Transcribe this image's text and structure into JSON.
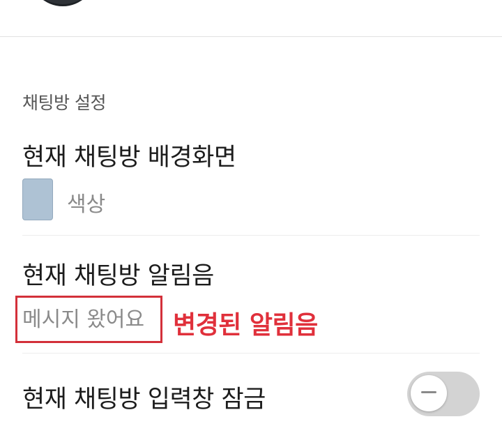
{
  "settings": {
    "section_title": "채팅방 설정",
    "background": {
      "title": "현재 채팅방 배경화면",
      "type_label": "색상",
      "swatch_color": "#aec2d4"
    },
    "notification_sound": {
      "title": "현재 채팅방 알림음",
      "value": "메시지 왔어요",
      "annotation": "변경된 알림음"
    },
    "input_lock": {
      "title": "현재 채팅방 입력창 잠금",
      "enabled": false
    }
  },
  "colors": {
    "highlight": "#d3303a",
    "annotation": "#e0303b"
  }
}
